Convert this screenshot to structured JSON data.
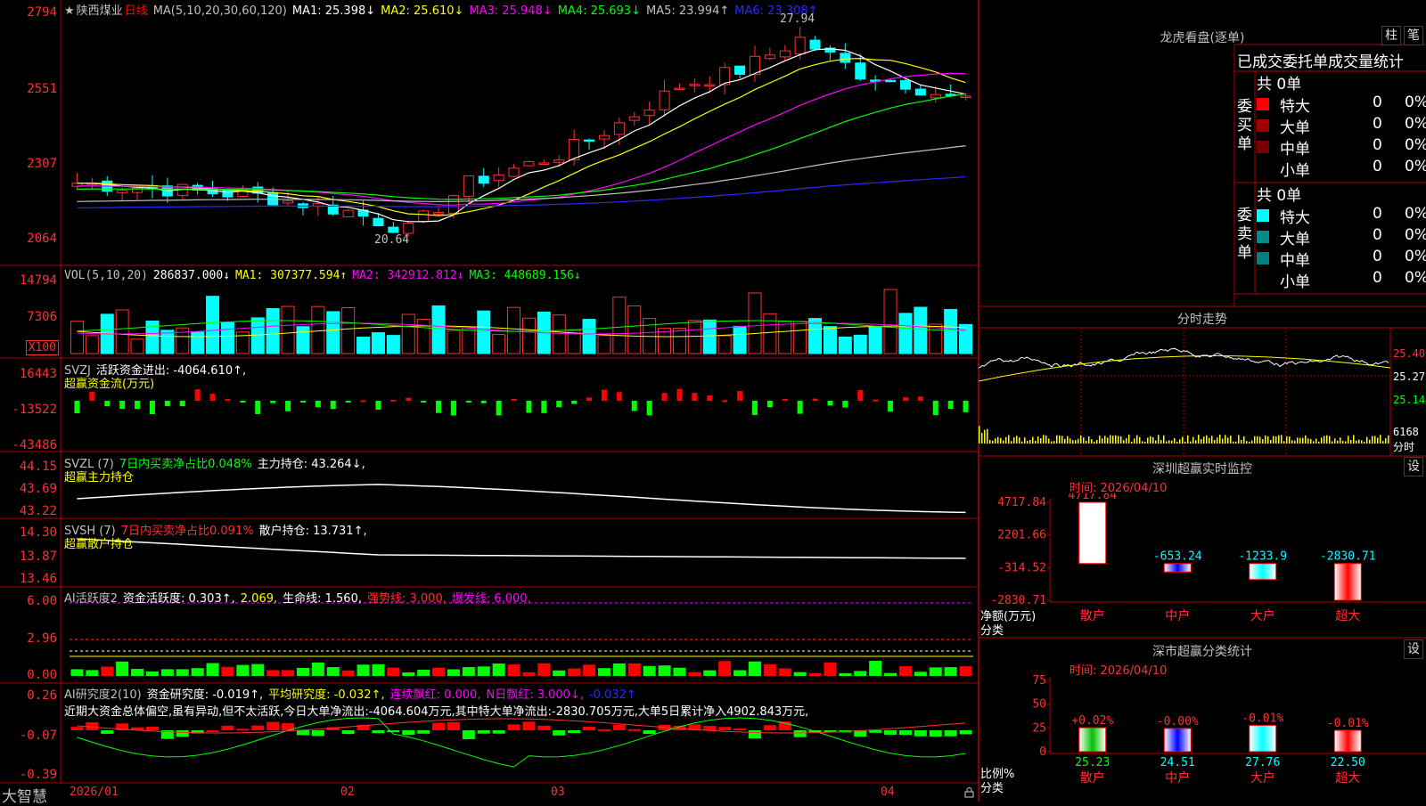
{
  "stock": {
    "star": "★",
    "name": "陕西煤业",
    "period": "日线",
    "ma_spec": "MA(5,10,20,30,60,120)",
    "ma": [
      {
        "label": "MA1:",
        "value": "25.398↓",
        "color": "#ffffff"
      },
      {
        "label": "MA2:",
        "value": "25.610↓",
        "color": "#ffff00"
      },
      {
        "label": "MA3:",
        "value": "25.948↓",
        "color": "#ff00ff"
      },
      {
        "label": "MA4:",
        "value": "25.693↓",
        "color": "#00ff00"
      },
      {
        "label": "MA5:",
        "value": "23.994↑",
        "color": "#c0c0c0"
      },
      {
        "label": "MA6:",
        "value": "23.308↑",
        "color": "#2a2aff"
      }
    ],
    "y_ticks": [
      "2794",
      "2551",
      "2307",
      "2064"
    ],
    "high_label": "27.94",
    "low_label": "20.64"
  },
  "vol": {
    "spec": "VOL(5,10,20)",
    "value": "286837.000↓",
    "ma1": "MA1: 307377.594↑",
    "ma2": "MA2: 342912.812↓",
    "ma3": "MA3: 448689.156↓",
    "y_ticks": [
      "14794",
      "7306"
    ],
    "unit": "X100"
  },
  "svzj": {
    "label": "SVZJ",
    "text": "活跃资金进出: -4064.610↑,",
    "sub": "超赢资金流(万元)",
    "y_ticks": [
      "16443",
      "-13522",
      "-43486"
    ]
  },
  "svzl": {
    "label": "SVZL (7)",
    "ratio": "7日内买卖净占比0.048%",
    "hold": "主力持仓: 43.264↓,",
    "sub": "超赢主力持仓",
    "y_ticks": [
      "44.15",
      "43.69",
      "43.22"
    ]
  },
  "svsh": {
    "label": "SVSH (7)",
    "ratio": "7日内买卖净占比0.091%",
    "hold": "散户持仓: 13.731↑,",
    "sub": "超赢散户持仓",
    "y_ticks": [
      "14.30",
      "13.87",
      "13.46"
    ]
  },
  "ai1": {
    "label": "AI活跃度2",
    "a": "资金活跃度: 0.303↑,",
    "b": "2.069,",
    "c": "生命线: 1.560,",
    "d": "强势线: 3.000,",
    "e": "爆发线: 6.000,",
    "y_ticks": [
      "6.00",
      "2.96",
      "0.00"
    ]
  },
  "ai2": {
    "label": "AI研究度2(10)",
    "a": "资金研究度: -0.019↑,",
    "b": "平均研究度: -0.032↑,",
    "c": "连续飘红: 0.000,",
    "d": "N日飘红: 3.000↓,",
    "e": "-0.032↑",
    "note": "近期大资金总体偏空,虽有异动,但不太活跃,今日大单净流出:-4064.604万元,其中特大单净流出:-2830.705万元,大单5日累计净入4902.843万元,",
    "y_ticks": [
      "0.26",
      "-0.07",
      "-0.39"
    ]
  },
  "dates": [
    "2026/01",
    "02",
    "03",
    "04"
  ],
  "brand": "大智慧",
  "right": {
    "lhb_title": "龙虎看盘(逐单)",
    "btn1": "柱",
    "btn2": "笔",
    "stats_title": "已成交委托单成交量统计",
    "buy": {
      "side": "委买单",
      "total": "共 0单",
      "rows": [
        {
          "name": "特大",
          "count": "0",
          "pct": "0%",
          "color": "#ff0000"
        },
        {
          "name": "大单",
          "count": "0",
          "pct": "0%",
          "color": "#a00000"
        },
        {
          "name": "中单",
          "count": "0",
          "pct": "0%",
          "color": "#780000"
        },
        {
          "name": "小单",
          "count": "0",
          "pct": "0%",
          "color": ""
        }
      ]
    },
    "sell": {
      "side": "委卖单",
      "total": "共 0单",
      "rows": [
        {
          "name": "特大",
          "count": "0",
          "pct": "0%",
          "color": "#00ffff"
        },
        {
          "name": "大单",
          "count": "0",
          "pct": "0%",
          "color": "#008c8c"
        },
        {
          "name": "中单",
          "count": "0",
          "pct": "0%",
          "color": "#008080"
        },
        {
          "name": "小单",
          "count": "0",
          "pct": "0%",
          "color": ""
        }
      ]
    },
    "intraday": {
      "title": "分时走势",
      "y_ticks": [
        "25.40",
        "25.27",
        "25.14"
      ],
      "vol_max": "6168",
      "unit": "分时"
    },
    "monitor": {
      "title": "深圳超赢实时监控",
      "btn": "设",
      "time": "时间: 2026/04/10",
      "y_ticks": [
        "4717.84",
        "2201.66",
        "-314.52",
        "-2830.71"
      ],
      "ylabel1": "净额(万元)",
      "ylabel2": "分类",
      "bars": [
        {
          "cat": "散户",
          "value": 4717.84,
          "label": "4717.84",
          "color": "#ffffff"
        },
        {
          "cat": "中户",
          "value": -653.24,
          "label": "-653.24",
          "color": "#0000ff"
        },
        {
          "cat": "大户",
          "value": -1233.9,
          "label": "-1233.9",
          "color": "#00ffff"
        },
        {
          "cat": "超大",
          "value": -2830.71,
          "label": "-2830.71",
          "color": "#ff0000"
        }
      ]
    },
    "classify": {
      "title": "深市超赢分类统计",
      "btn": "设",
      "time": "时间: 2026/04/10",
      "y_ticks": [
        "75",
        "50",
        "25",
        "0"
      ],
      "ylabel1": "比例%",
      "ylabel2": "分类",
      "bars": [
        {
          "cat": "散户",
          "value": 25.23,
          "top": "+0.02%",
          "label": "25.23",
          "color": "#00c000"
        },
        {
          "cat": "中户",
          "value": 24.51,
          "top": "-0.00%",
          "label": "24.51",
          "color": "#0000ff"
        },
        {
          "cat": "大户",
          "value": 27.76,
          "top": "-0.01%",
          "label": "27.76",
          "color": "#00ffff"
        },
        {
          "cat": "超大",
          "value": 22.5,
          "top": "-0.01%",
          "label": "22.50",
          "color": "#ff0000"
        }
      ]
    }
  }
}
